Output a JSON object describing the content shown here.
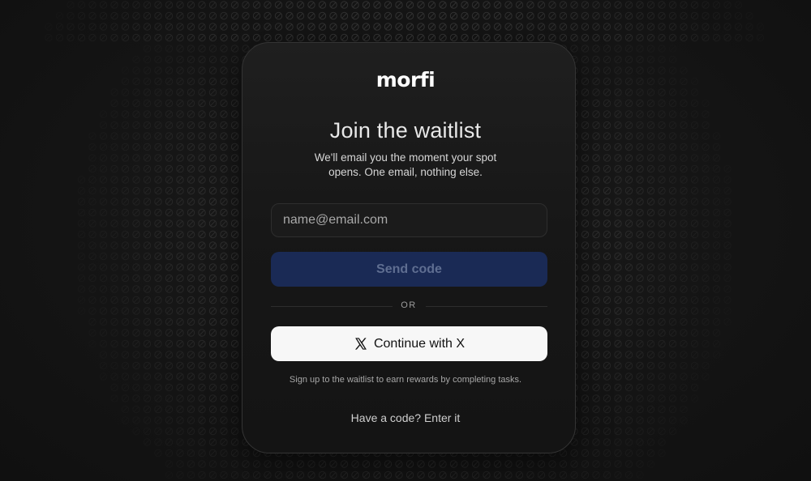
{
  "brand": {
    "logo_text": "morfi"
  },
  "waitlist": {
    "title": "Join the waitlist",
    "subtitle": "We'll email you the moment your spot opens. One email, nothing else.",
    "email_placeholder": "name@email.com",
    "send_code_label": "Send code",
    "divider_label": "OR",
    "continue_x_label": "Continue with X",
    "continue_x_icon": "x-logo-icon",
    "info_text": "Sign up to the waitlist to earn rewards by completing tasks.",
    "have_code_text": "Have a code? Enter it"
  },
  "colors": {
    "background": "#151515",
    "card": "#1a1a1a",
    "send_button": "#1a2a55",
    "send_button_text": "#5f6e91",
    "x_button": "#f7f7f7"
  }
}
